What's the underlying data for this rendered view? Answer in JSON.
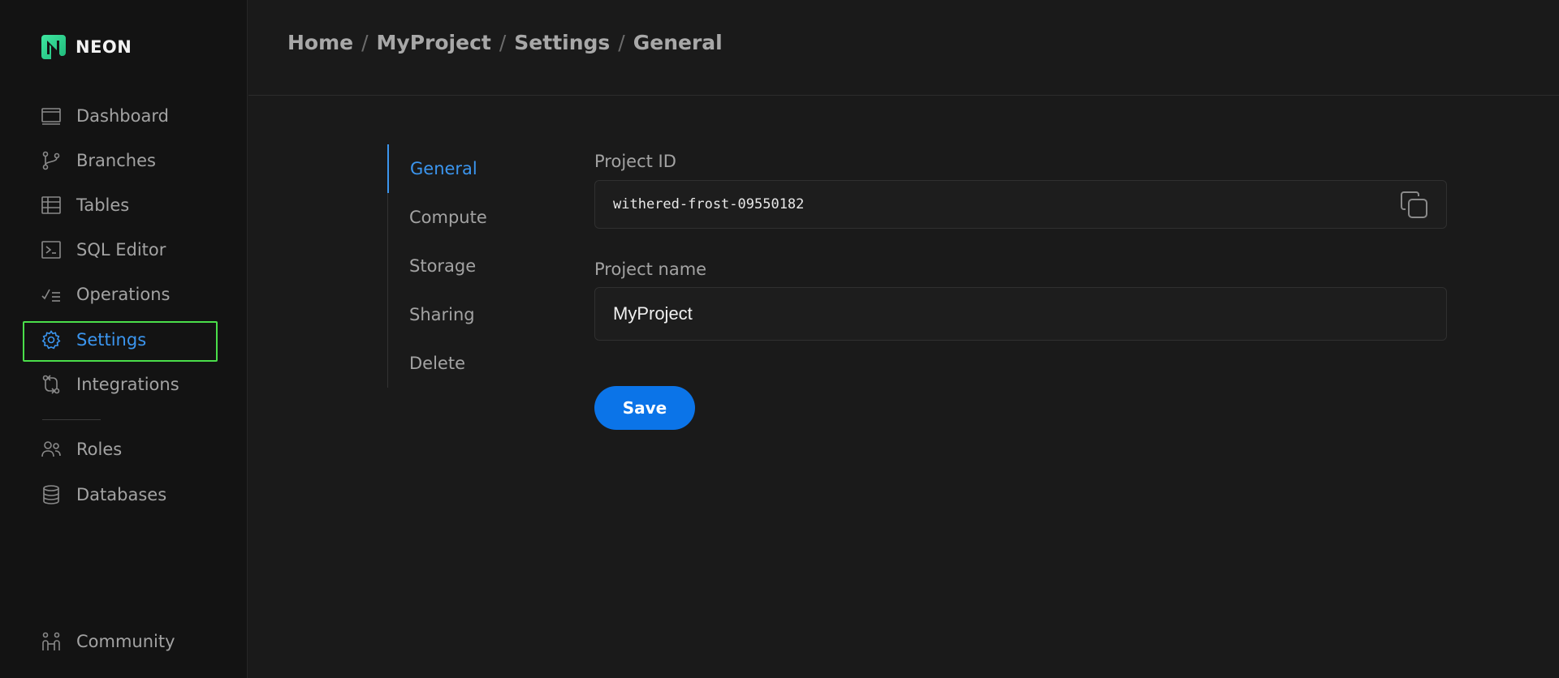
{
  "app": {
    "logo_text": "NEON",
    "accent_color": "#3b95ee",
    "brand_color": "#3ee6a0"
  },
  "sidebar": {
    "items": [
      {
        "label": "Dashboard",
        "icon": "dashboard-icon"
      },
      {
        "label": "Branches",
        "icon": "branch-icon"
      },
      {
        "label": "Tables",
        "icon": "table-icon"
      },
      {
        "label": "SQL Editor",
        "icon": "terminal-icon"
      },
      {
        "label": "Operations",
        "icon": "checklist-icon"
      },
      {
        "label": "Settings",
        "icon": "gear-icon",
        "active": true
      },
      {
        "label": "Integrations",
        "icon": "integrations-icon"
      }
    ],
    "secondary_items": [
      {
        "label": "Roles",
        "icon": "users-icon"
      },
      {
        "label": "Databases",
        "icon": "database-icon"
      }
    ],
    "footer_items": [
      {
        "label": "Community",
        "icon": "community-icon"
      }
    ]
  },
  "breadcrumb": [
    "Home",
    "MyProject",
    "Settings",
    "General"
  ],
  "settings_nav": {
    "items": [
      "General",
      "Compute",
      "Storage",
      "Sharing",
      "Delete"
    ],
    "active": "General"
  },
  "form": {
    "project_id_label": "Project ID",
    "project_id_value": "withered-frost-09550182",
    "project_name_label": "Project name",
    "project_name_value": "MyProject",
    "save_label": "Save"
  }
}
